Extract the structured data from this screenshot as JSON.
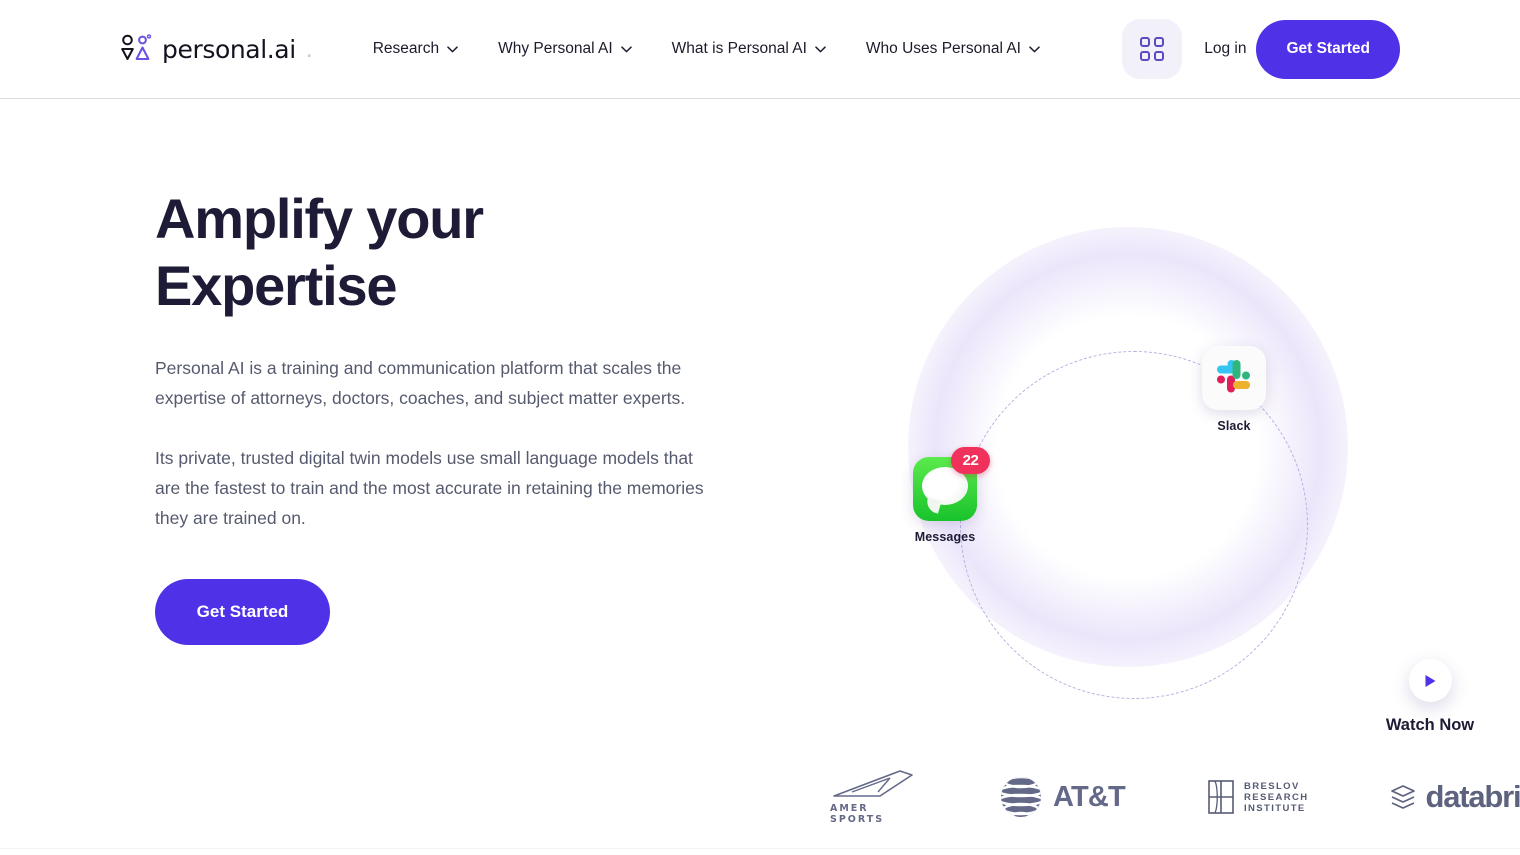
{
  "brand": {
    "name": "personal.ai",
    "trailing_dot": ".",
    "logo_icon": "personal-ai-logomark"
  },
  "nav": {
    "items": [
      {
        "label": "Research",
        "icon": "chevron-down-icon"
      },
      {
        "label": "Why Personal AI",
        "icon": "chevron-down-icon"
      },
      {
        "label": "What is Personal AI",
        "icon": "chevron-down-icon"
      },
      {
        "label": "Who Uses Personal AI",
        "icon": "chevron-down-icon"
      }
    ]
  },
  "header": {
    "apps_icon": "grid-apps-icon",
    "login_label": "Log in",
    "get_started_label": "Get Started"
  },
  "hero": {
    "title_line1": "Amplify your",
    "title_line2": "Expertise",
    "paragraph1": "Personal AI is a training and communication platform that scales the expertise of attorneys, doctors, coaches, and subject matter experts.",
    "paragraph2": "Its private, trusted digital twin models use small language models that are the fastest to train and the most accurate in retaining the memories they are trained on.",
    "cta_label": "Get Started"
  },
  "orbit": {
    "apps": [
      {
        "name": "Messages",
        "icon": "messages-app-icon",
        "badge": "22"
      },
      {
        "name": "Slack",
        "icon": "slack-app-icon"
      }
    ]
  },
  "watch": {
    "label": "Watch Now",
    "icon": "play-icon"
  },
  "logos": [
    {
      "name": "AMER SPORTS",
      "icon": "amer-sports-logo"
    },
    {
      "name": "AT&T",
      "icon": "att-logo"
    },
    {
      "name": "BRESLOV\nRESEARCH\nINSTITUTE",
      "line1": "BRESLOV",
      "line2": "RESEARCH",
      "line3": "INSTITUTE",
      "icon": "breslov-logo"
    },
    {
      "name": "databri",
      "icon": "databricks-logo"
    }
  ],
  "colors": {
    "accent": "#4f32e8",
    "accent_soft": "#f2f1fa",
    "heading": "#1d1b35",
    "body_text": "#565a6e",
    "badge_red": "#f0315b",
    "logo_gray": "#5c6282"
  }
}
